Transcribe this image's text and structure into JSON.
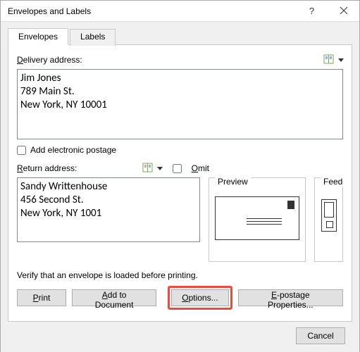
{
  "window": {
    "title": "Envelopes and Labels"
  },
  "tabs": {
    "envelopes": "Envelopes",
    "labels": "Labels"
  },
  "delivery": {
    "label_pre": "",
    "label_key": "D",
    "label_post": "elivery address:",
    "value": "Jim Jones\n789 Main St.\nNew York, NY 10001"
  },
  "electronic_postage": {
    "label": "Add electronic postage",
    "checked": false
  },
  "return": {
    "label_key": "R",
    "label_post": "eturn address:",
    "value": "Sandy Writtenhouse\n456 Second St.\nNew York, NY 1001"
  },
  "omit": {
    "label_key": "O",
    "label_post": "mit",
    "checked": false
  },
  "preview": {
    "legend": "Preview"
  },
  "feed": {
    "legend": "Feed"
  },
  "verify_text": "Verify that an envelope is loaded before printing.",
  "buttons": {
    "print_key": "P",
    "print_post": "rint",
    "add_pre": "",
    "add_key": "A",
    "add_post": "dd to Document",
    "options_key": "O",
    "options_post": "ptions...",
    "epostage_pre": "",
    "epostage_key": "E",
    "epostage_post": "-postage Properties...",
    "cancel": "Cancel"
  }
}
